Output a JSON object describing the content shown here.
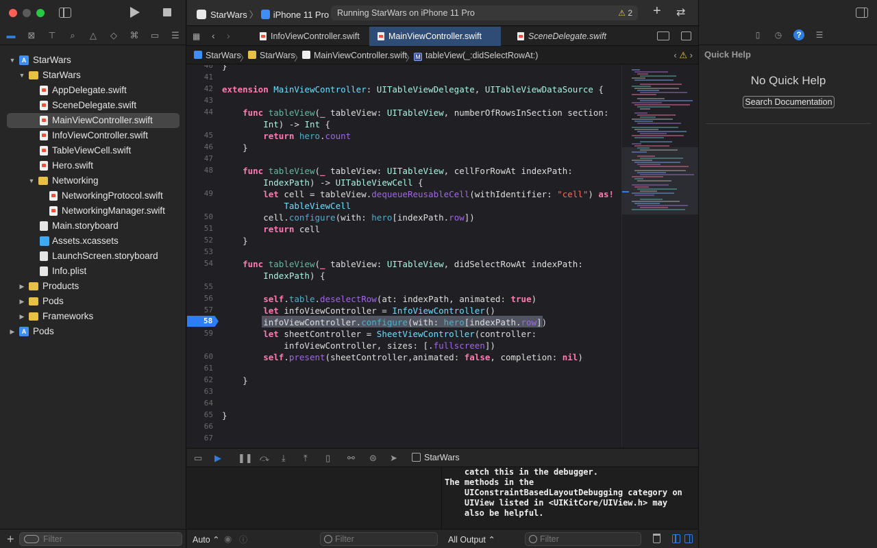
{
  "toolbar": {
    "scheme": "StarWars",
    "device": "iPhone 11 Pro",
    "activity": "Running StarWars on iPhone 11 Pro",
    "warning_count": "2",
    "add_icon": "+",
    "swap_icon": "⇄"
  },
  "navigator": {
    "tree": [
      {
        "label": "StarWars",
        "icon": "project-icon",
        "disclosure": "▼"
      },
      {
        "label": "StarWars",
        "icon": "folder-icon",
        "disclosure": "▼"
      },
      {
        "label": "AppDelegate.swift",
        "icon": "swift-file-icon"
      },
      {
        "label": "SceneDelegate.swift",
        "icon": "swift-file-icon"
      },
      {
        "label": "MainViewController.swift",
        "icon": "swift-file-icon",
        "selected": true
      },
      {
        "label": "InfoViewController.swift",
        "icon": "swift-file-icon"
      },
      {
        "label": "TableViewCell.swift",
        "icon": "swift-file-icon"
      },
      {
        "label": "Hero.swift",
        "icon": "swift-file-icon"
      },
      {
        "label": "Networking",
        "icon": "folder-icon",
        "disclosure": "▼"
      },
      {
        "label": "NetworkingProtocol.swift",
        "icon": "swift-file-icon"
      },
      {
        "label": "NetworkingManager.swift",
        "icon": "swift-file-icon"
      },
      {
        "label": "Main.storyboard",
        "icon": "storyboard-icon"
      },
      {
        "label": "Assets.xcassets",
        "icon": "assets-icon"
      },
      {
        "label": "LaunchScreen.storyboard",
        "icon": "storyboard-icon"
      },
      {
        "label": "Info.plist",
        "icon": "plist-icon"
      },
      {
        "label": "Products",
        "icon": "folder-icon",
        "disclosure": "▶"
      },
      {
        "label": "Pods",
        "icon": "folder-icon",
        "disclosure": "▶"
      },
      {
        "label": "Frameworks",
        "icon": "folder-icon",
        "disclosure": "▶"
      },
      {
        "label": "Pods",
        "icon": "project-icon",
        "disclosure": "▶"
      }
    ],
    "filter_placeholder": "Filter",
    "add_icon": "+"
  },
  "editor": {
    "tabs": [
      {
        "label": "InfoViewController.swift",
        "active": false
      },
      {
        "label": "MainViewController.swift",
        "active": true
      },
      {
        "label": "SceneDelegate.swift",
        "active": false
      }
    ],
    "jumpbar": {
      "project": "StarWars",
      "group": "StarWars",
      "file": "MainViewController.swift",
      "symbol": "tableView(_:didSelectRowAt:)",
      "symbol_badge": "M"
    },
    "line_numbers": [
      "40",
      "41",
      "42",
      "43",
      "44",
      "",
      "45",
      "46",
      "47",
      "48",
      "",
      "49",
      "",
      "50",
      "51",
      "52",
      "53",
      "54",
      "",
      "55",
      "56",
      "57",
      "58",
      "59",
      "",
      "60",
      "61",
      "62",
      "63",
      "64",
      "65",
      "66",
      "67"
    ],
    "breakpoint_line": "58"
  },
  "inspector": {
    "title": "Quick Help",
    "empty": "No Quick Help",
    "search_button": "Search Documentation",
    "help_icon": "?"
  },
  "debug": {
    "scheme": "StarWars",
    "console_lines": [
      "    catch this in the debugger.",
      "The methods in the",
      "    UIConstraintBasedLayoutDebugging category on",
      "    UIView listed in <UIKitCore/UIView.h> may",
      "    also be helpful."
    ],
    "auto_label": "Auto ⌃",
    "variables_filter": "Filter",
    "output_label": "All Output ⌃",
    "console_filter": "Filter"
  },
  "colors": {
    "accent": "#2f7de1",
    "breakpoint": "#2d7df5",
    "keyword": "#ff7ab2",
    "type": "#6bdfff",
    "string": "#fc6a5d",
    "property": "#a167e6"
  }
}
